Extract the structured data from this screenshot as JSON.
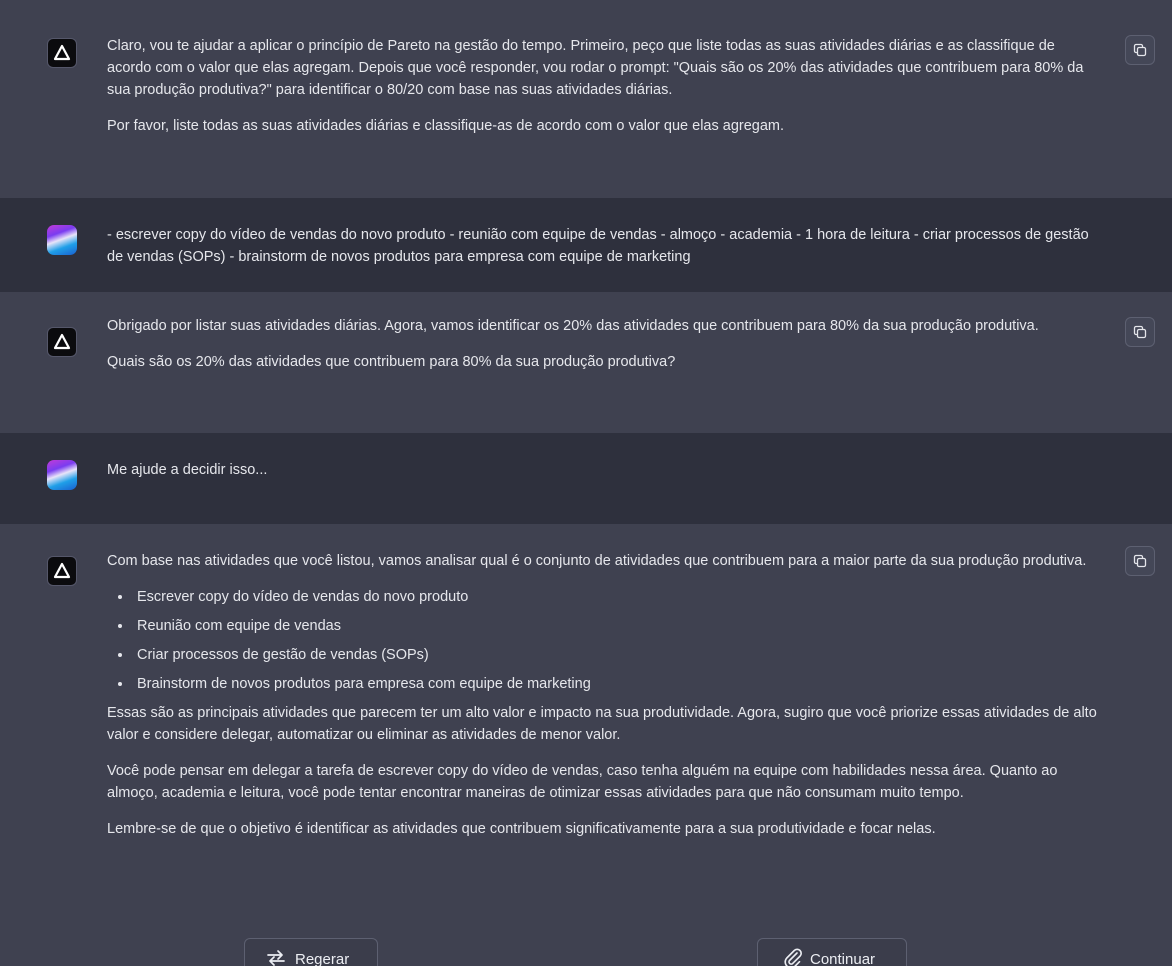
{
  "messages": [
    {
      "role": "assistant",
      "paragraphs": [
        "Claro, vou te ajudar a aplicar o princípio de Pareto na gestão do tempo. Primeiro, peço que liste todas as suas atividades diárias e as classifique de acordo com o valor que elas agregam. Depois que você responder, vou rodar o prompt: \"Quais são os 20% das atividades que contribuem para 80% da sua produção produtiva?\" para identificar o 80/20 com base nas suas atividades diárias.",
        "Por favor, liste todas as suas atividades diárias e classifique-as de acordo com o valor que elas agregam."
      ]
    },
    {
      "role": "user",
      "text": "- escrever copy do vídeo de vendas do novo produto - reunião com equipe de vendas - almoço - academia - 1 hora de leitura - criar processos de gestão de vendas (SOPs) - brainstorm de novos produtos para empresa com equipe de marketing"
    },
    {
      "role": "assistant",
      "paragraphs": [
        "Obrigado por listar suas atividades diárias. Agora, vamos identificar os 20% das atividades que contribuem para 80% da sua produção produtiva.",
        "Quais são os 20% das atividades que contribuem para 80% da sua produção produtiva?"
      ]
    },
    {
      "role": "user",
      "text": "Me ajude a decidir isso..."
    },
    {
      "role": "assistant",
      "intro": "Com base nas atividades que você listou, vamos analisar qual é o conjunto de atividades que contribuem para a maior parte da sua produção produtiva.",
      "bullets": [
        "Escrever copy do vídeo de vendas do novo produto",
        "Reunião com equipe de vendas",
        "Criar processos de gestão de vendas (SOPs)",
        "Brainstorm de novos produtos para empresa com equipe de marketing"
      ],
      "paragraphs": [
        "Essas são as principais atividades que parecem ter um alto valor e impacto na sua produtividade. Agora, sugiro que você priorize essas atividades de alto valor e considere delegar, automatizar ou eliminar as atividades de menor valor.",
        "Você pode pensar em delegar a tarefa de escrever copy do vídeo de vendas, caso tenha alguém na equipe com habilidades nessa área. Quanto ao almoço, academia e leitura, você pode tentar encontrar maneiras de otimizar essas atividades para que não consumam muito tempo.",
        "Lembre-se de que o objetivo é identificar as atividades que contribuem significativamente para a sua produtividade e focar nelas."
      ]
    }
  ],
  "actions": {
    "regenerate_label": "Regerar",
    "regenerate_icon": "regenerate-icon",
    "continue_label": "Continuar",
    "continue_icon": "continue-icon"
  },
  "icons": {
    "assistant_avatar": "delta-logo-icon",
    "copy": "copy-icon"
  },
  "colors": {
    "assistant_bg": "#3f4150",
    "user_bg": "#2e303d",
    "text": "#e6e7ec"
  }
}
